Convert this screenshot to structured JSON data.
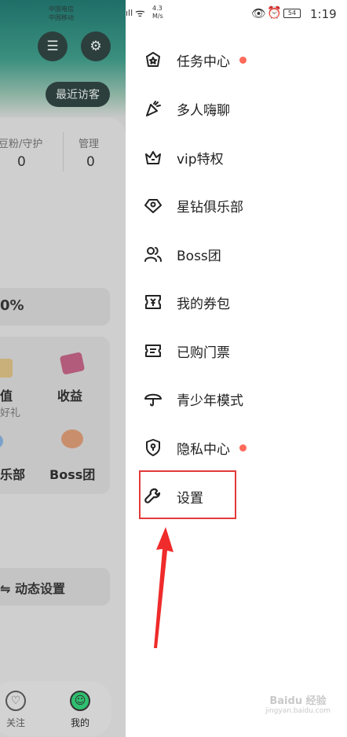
{
  "background": {
    "carrier_lines": [
      "中国电信",
      "中国移动"
    ],
    "visitors_label": "最近访客",
    "stats": [
      {
        "label": "豆粉/守护",
        "value": "0"
      },
      {
        "label": "管理",
        "value": "0"
      }
    ],
    "percent_text": "0%",
    "grid": {
      "item1_label": "值",
      "item1_sub": "好礼",
      "item2_label": "收益",
      "item3_label": "乐部",
      "item4_label": "Boss团"
    },
    "dynamic_settings_label": "动态设置",
    "tabs": [
      {
        "label": "关注"
      },
      {
        "label": "我的"
      }
    ],
    "colors": {
      "accent": "#2fbf6f"
    }
  },
  "status_bar": {
    "network_speed_value": "4.3",
    "network_speed_unit": "M/s",
    "battery": "54",
    "time": "1:19"
  },
  "menu": {
    "items": [
      {
        "label": "任务中心",
        "icon": "star-badge-icon",
        "dot": true
      },
      {
        "label": "多人嗨聊",
        "icon": "party-popper-icon",
        "dot": false
      },
      {
        "label": "vip特权",
        "icon": "crown-icon",
        "dot": false
      },
      {
        "label": "星钻俱乐部",
        "icon": "diamond-icon",
        "dot": false
      },
      {
        "label": "Boss团",
        "icon": "users-icon",
        "dot": false
      },
      {
        "label": "我的券包",
        "icon": "coupon-icon",
        "dot": false
      },
      {
        "label": "已购门票",
        "icon": "ticket-icon",
        "dot": false
      },
      {
        "label": "青少年模式",
        "icon": "umbrella-icon",
        "dot": false
      },
      {
        "label": "隐私中心",
        "icon": "shield-icon",
        "dot": true
      },
      {
        "label": "设置",
        "icon": "wrench-icon",
        "dot": false
      }
    ],
    "dot_color": "#ff6a5a"
  },
  "annotation": {
    "highlight_color": "#e23a3a"
  },
  "watermark": {
    "line1": "Baidu 经验",
    "line2": "jingyan.baidu.com"
  }
}
